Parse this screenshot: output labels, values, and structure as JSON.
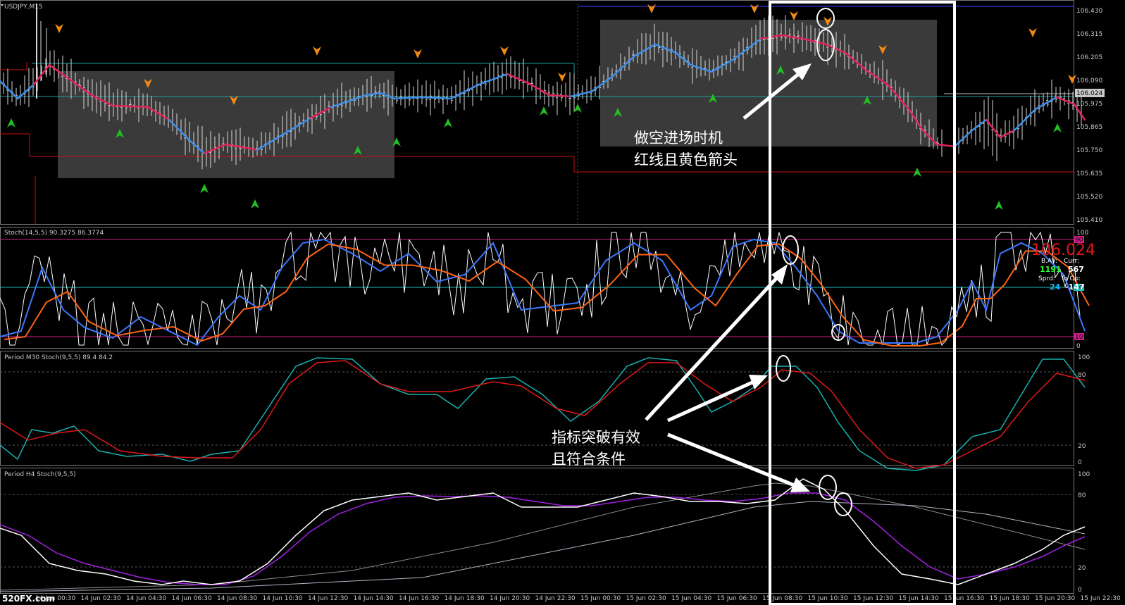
{
  "chart_data": [
    {
      "type": "candlestick",
      "panel_label": "USDJPY,M15",
      "y_ticks": [
        "106.430",
        "106.315",
        "106.205",
        "106.090",
        "105.975",
        "105.865",
        "105.750",
        "105.635",
        "105.520",
        "105.410"
      ],
      "ylim": [
        105.41,
        106.43
      ],
      "current_price": "106.024",
      "levels": {
        "upper_channel": 106.21,
        "middle": 106.03,
        "lower_channel": 105.72,
        "low_shift": 105.66,
        "top": 106.43
      },
      "ma_colors": {
        "up": "#3c8ee8",
        "down": "#e0245a"
      },
      "arrow_colors": {
        "buy": "#22c022",
        "sell": "#f08a14"
      },
      "consolidation_boxes": 2
    },
    {
      "type": "line",
      "panel_label": "Stoch(14,5,5) 90.3275 86.3774",
      "ylim": [
        0,
        100
      ],
      "levels": [
        90,
        50,
        10
      ],
      "level_labels": [
        "90",
        "50",
        "10"
      ],
      "level_colors": [
        "#d0208c",
        "#18c0c0",
        "#d0208c"
      ],
      "y_ticks": [
        "100",
        "0"
      ],
      "series_colors": {
        "main": "#ffffff",
        "k": "#3c78ff",
        "d": "#ff6414"
      },
      "info_box": {
        "price": "106.024",
        "rows": [
          {
            "l1": "B.AV:",
            "v1": "",
            "l2": "Curr:",
            "v2": ""
          },
          {
            "l1": "",
            "v1": "1191",
            "l2": "",
            "v2": "567"
          },
          {
            "l1": "Sprd:",
            "v1": "",
            "l2": "To Op:",
            "v2": ""
          },
          {
            "l1": "",
            "v1": "24",
            "l2": "",
            "v2": "-147"
          }
        ]
      }
    },
    {
      "type": "line",
      "panel_label": "Period M30 Stoch(9,5,5) 89.4 84.2",
      "ylim": [
        0,
        100
      ],
      "y_ticks": [
        "100",
        "80",
        "20",
        "0"
      ],
      "series_colors": {
        "k": "#18b0b0",
        "d": "#e01818"
      }
    },
    {
      "type": "line",
      "panel_label": "Period H4 Stoch(9,5,5)",
      "ylim": [
        0,
        100
      ],
      "y_ticks": [
        "100",
        "80",
        "20",
        "0"
      ],
      "series_colors": {
        "k": "#ffffff",
        "d": "#a020e0",
        "slow1": "#8c8c8c",
        "slow2": "#b4b4c8"
      }
    }
  ],
  "x_labels": [
    "14 Jun 00:30",
    "14 Jun 02:30",
    "14 Jun 04:30",
    "14 Jun 06:30",
    "14 Jun 08:30",
    "14 Jun 10:30",
    "14 Jun 12:30",
    "14 Jun 14:30",
    "14 Jun 16:30",
    "14 Jun 18:30",
    "14 Jun 20:30",
    "14 Jun 22:30",
    "15 Jun 00:30",
    "15 Jun 02:30",
    "15 Jun 04:30",
    "15 Jun 06:30",
    "15 Jun 08:30",
    "15 Jun 10:30",
    "15 Jun 12:30",
    "15 Jun 14:30",
    "15 Jun 16:30",
    "15 Jun 18:30",
    "15 Jun 20:30",
    "15 Jun 22:30"
  ],
  "annotations": {
    "entry_line1": "做空进场时机",
    "entry_line2": "红线且黄色箭头",
    "break_line1": "指标突破有效",
    "break_line2": "且符合条件"
  },
  "watermark": "520FX.com"
}
